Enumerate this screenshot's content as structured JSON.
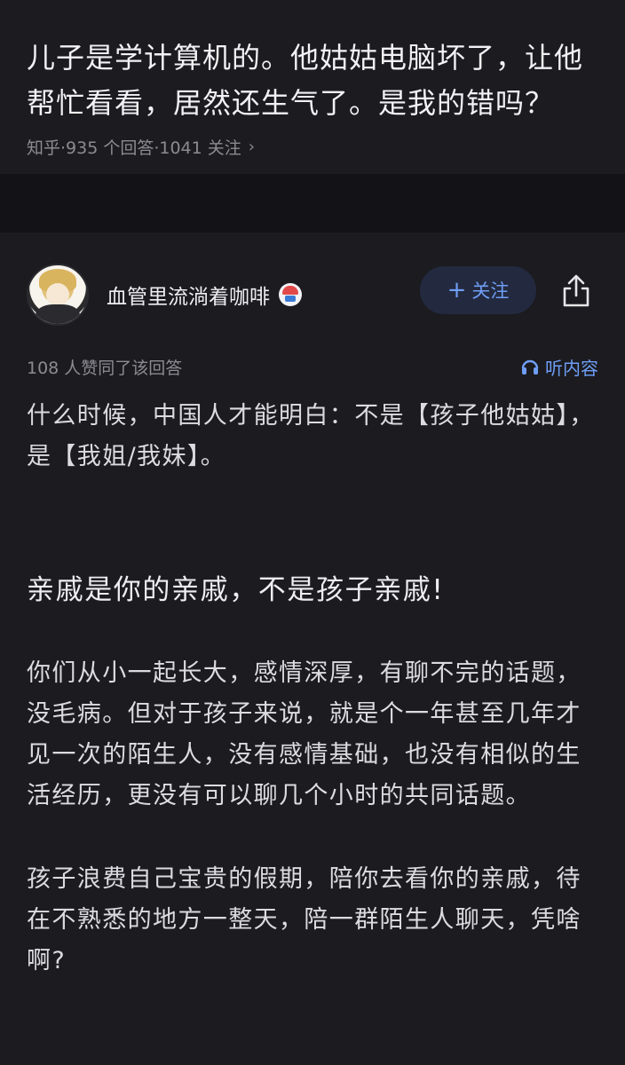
{
  "question": {
    "title": "儿子是学计算机的。他姑姑电脑坏了，让他帮忙看看，居然还生气了。是我的错吗？",
    "meta": "知乎·935 个回答·1041 关注",
    "chevron": "›"
  },
  "answer": {
    "author_name": "血管里流淌着咖啡",
    "follow_label": "关注",
    "follow_plus": "+",
    "likes_text": "108 人赞同了该回答",
    "listen_label": "听内容",
    "paragraphs": {
      "p1": "什么时候，中国人才能明白：不是【孩子他姑姑】，是【我姐/我妹】。",
      "heading": "亲戚是你的亲戚，不是孩子亲戚!",
      "p2": "你们从小一起长大，感情深厚，有聊不完的话题，没毛病。但对于孩子来说，就是个一年甚至几年才见一次的陌生人，没有感情基础，也没有相似的生活经历，更没有可以聊几个小时的共同话题。",
      "p3": "孩子浪费自己宝贵的假期，陪你去看你的亲戚，待在不熟悉的地方一整天，陪一群陌生人聊天，凭啥啊?"
    }
  },
  "colors": {
    "background": "#131317",
    "card": "#1b1b20",
    "accent": "#6f9ef6",
    "muted_text": "#8b8b92"
  },
  "icons": {
    "share": "share-icon",
    "headphones": "headphones-icon",
    "badge": "badge-icon",
    "chevron": "chevron-right-icon"
  }
}
